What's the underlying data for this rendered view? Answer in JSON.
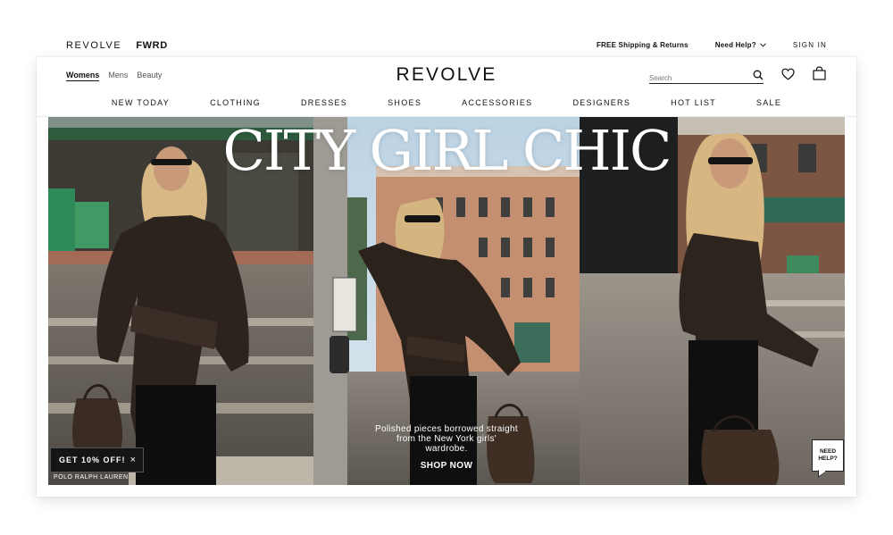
{
  "brands": {
    "primary": "REVOLVE",
    "secondary": "FWRD"
  },
  "utility": {
    "shipping": "FREE Shipping & Returns",
    "help": "Need Help?",
    "signin": "SIGN IN"
  },
  "header": {
    "logo": "REVOLVE",
    "gender_tabs": [
      "Womens",
      "Mens",
      "Beauty"
    ],
    "search_placeholder": "Search"
  },
  "nav": [
    "NEW TODAY",
    "CLOTHING",
    "DRESSES",
    "SHOES",
    "ACCESSORIES",
    "DESIGNERS",
    "HOT LIST",
    "SALE"
  ],
  "hero": {
    "title": "CITY GIRL CHIC",
    "caption": "Polished pieces borrowed straight from the New York girls' wardrobe.",
    "cta": "SHOP NOW",
    "brand_label": "POLO RALPH LAUREN"
  },
  "promo": {
    "discount": "GET 10% OFF!",
    "close": "×"
  },
  "chat": {
    "line1": "NEED",
    "line2": "HELP?"
  },
  "icons": {
    "search": "search-icon",
    "heart": "heart-icon",
    "bag": "bag-icon",
    "chevron": "chevron-down-icon",
    "close": "close-icon"
  },
  "colors": {
    "dark": "#151515",
    "text": "#111111",
    "muted": "#555555"
  }
}
